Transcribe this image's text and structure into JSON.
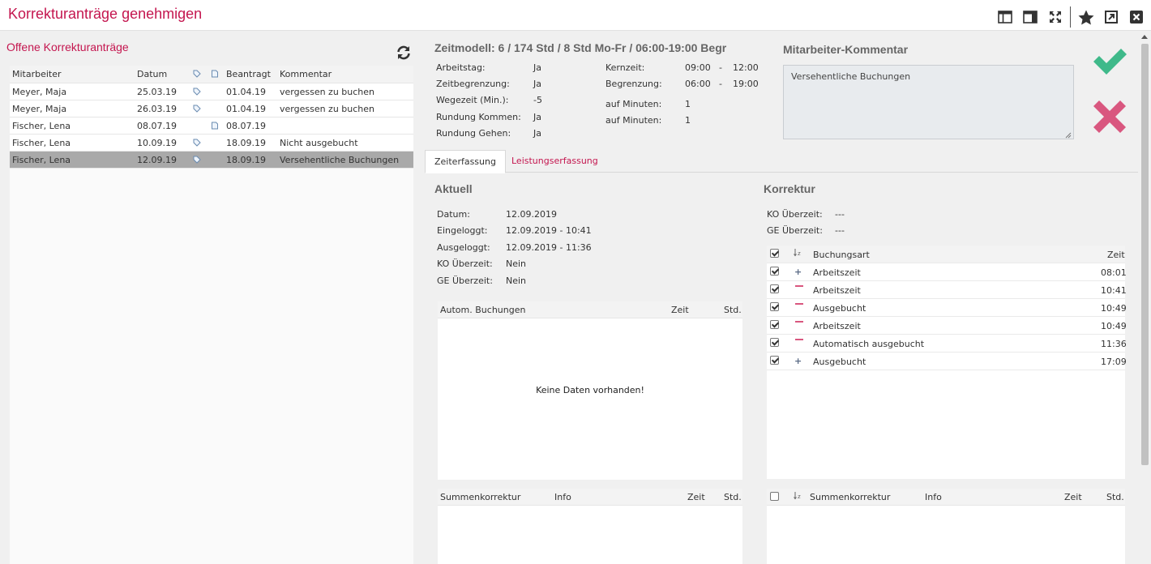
{
  "window": {
    "title": "Korrekturanträge genehmigen"
  },
  "left": {
    "title": "Offene Korrekturanträge",
    "columns": {
      "mitarbeiter": "Mitarbeiter",
      "datum": "Datum",
      "beantragt": "Beantragt",
      "kommentar": "Kommentar"
    },
    "rows": [
      {
        "mitarbeiter": "Meyer, Maja",
        "datum": "25.03.19",
        "beantragt": "01.04.19",
        "kommentar": "vergessen zu buchen"
      },
      {
        "mitarbeiter": "Meyer, Maja",
        "datum": "26.03.19",
        "beantragt": "01.04.19",
        "kommentar": "vergessen zu buchen"
      },
      {
        "mitarbeiter": "Fischer, Lena",
        "datum": "08.07.19",
        "beantragt": "08.07.19",
        "kommentar": ""
      },
      {
        "mitarbeiter": "Fischer, Lena",
        "datum": "10.09.19",
        "beantragt": "18.09.19",
        "kommentar": "Nicht ausgebucht"
      },
      {
        "mitarbeiter": "Fischer, Lena",
        "datum": "12.09.19",
        "beantragt": "18.09.19",
        "kommentar": "Versehentliche Buchungen"
      }
    ]
  },
  "zeitmodell": {
    "title": "Zeitmodell: 6 / 174 Std / 8 Std Mo-Fr / 06:00-19:00 Begr",
    "arbeitstag_label": "Arbeitstag:",
    "arbeitstag": "Ja",
    "zeitbegrenzung_label": "Zeitbegrenzung:",
    "zeitbegrenzung": "Ja",
    "wegezeit_label": "Wegezeit (Min.):",
    "wegezeit": "-5",
    "rundung_kommen_label": "Rundung Kommen:",
    "rundung_kommen": "Ja",
    "rundung_gehen_label": "Rundung Gehen:",
    "rundung_gehen": "Ja",
    "kernzeit_label": "Kernzeit:",
    "kernzeit_from": "09:00",
    "kernzeit_dash": "-",
    "kernzeit_to": "12:00",
    "begrenzung_label": "Begrenzung:",
    "begrenzung_from": "06:00",
    "begrenzung_dash": "-",
    "begrenzung_to": "19:00",
    "auf_minuten_label": "auf Minuten:",
    "auf_minuten_1": "1",
    "auf_minuten_2": "1"
  },
  "kommentar": {
    "title": "Mitarbeiter-Kommentar",
    "text": "Versehentliche Buchungen"
  },
  "tabs": {
    "zeiterfassung": "Zeiterfassung",
    "leistungserfassung": "Leistungserfassung"
  },
  "aktuell": {
    "title": "Aktuell",
    "datum_label": "Datum:",
    "datum": "12.09.2019",
    "eingeloggt_label": "Eingeloggt:",
    "eingeloggt": "12.09.2019 - 10:41",
    "ausgeloggt_label": "Ausgeloggt:",
    "ausgeloggt": "12.09.2019 - 11:36",
    "ko_label": "KO Überzeit:",
    "ko": "Nein",
    "ge_label": "GE Überzeit:",
    "ge": "Nein",
    "autom": {
      "col_buchungen": "Autom. Buchungen",
      "col_zeit": "Zeit",
      "col_std": "Std.",
      "empty": "Keine Daten vorhanden!"
    },
    "summe": {
      "col_summe": "Summenkorrektur",
      "col_info": "Info",
      "col_zeit": "Zeit",
      "col_std": "Std."
    }
  },
  "korrektur": {
    "title": "Korrektur",
    "ko_label": "KO Überzeit:",
    "ko": "---",
    "ge_label": "GE Überzeit:",
    "ge": "---",
    "col_buchungsart": "Buchungsart",
    "col_zeit": "Zeit",
    "rows": [
      {
        "sign": "plus",
        "art": "Arbeitszeit",
        "zeit": "08:01"
      },
      {
        "sign": "minus",
        "art": "Arbeitszeit",
        "zeit": "10:41"
      },
      {
        "sign": "minus",
        "art": "Ausgebucht",
        "zeit": "10:49"
      },
      {
        "sign": "minus",
        "art": "Arbeitszeit",
        "zeit": "10:49"
      },
      {
        "sign": "minus",
        "art": "Automatisch ausgebucht",
        "zeit": "11:36"
      },
      {
        "sign": "plus",
        "art": "Ausgebucht",
        "zeit": "17:09"
      }
    ],
    "summe": {
      "col_summe": "Summenkorrektur",
      "col_info": "Info",
      "col_zeit": "Zeit",
      "col_std": "Std."
    }
  },
  "colors": {
    "accent": "#c4164f",
    "approve": "#3fb98a",
    "reject": "#d9577f"
  }
}
